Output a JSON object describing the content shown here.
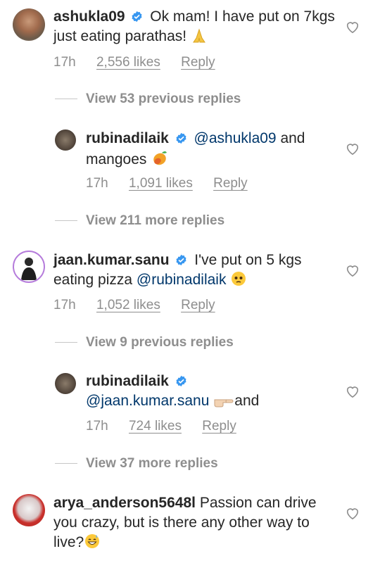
{
  "comments": [
    {
      "username": "ashukla09",
      "text_before": "Ok mam! I have put on 7kgs just eating parathas!",
      "time": "17h",
      "likes": "2,556 likes",
      "reply": "Reply"
    },
    {
      "username": "rubinadilaik",
      "mention": "@ashukla09",
      "text_after": " and mangoes",
      "time": "17h",
      "likes": "1,091 likes",
      "reply": "Reply"
    },
    {
      "username": "jaan.kumar.sanu",
      "text_before": "I've put on 5 kgs eating pizza",
      "mention": "@rubinadilaik",
      "time": "17h",
      "likes": "1,052 likes",
      "reply": "Reply"
    },
    {
      "username": "rubinadilaik",
      "mention": "@jaan.kumar.sanu",
      "text_after": "and",
      "time": "17h",
      "likes": "724 likes",
      "reply": "Reply"
    },
    {
      "username": "arya_anderson5648l",
      "text_before": "Passion can drive you crazy, but is there any other way to live?"
    }
  ],
  "view_rows": [
    "View 53 previous replies",
    "View 211 more replies",
    "View 9 previous replies",
    "View 37 more replies"
  ],
  "icons": {
    "verified": "verified-badge-icon",
    "heart": "heart-outline-icon",
    "praying_hands": "praying-hands-emoji",
    "mango": "mango-emoji",
    "pleading_face": "pleading-face-emoji",
    "pointing_hand": "pointing-hand-emoji",
    "grinning_sweat": "grinning-sweat-emoji"
  },
  "colors": {
    "verified": "#3897f0",
    "mention": "#00376b",
    "secondary": "#8e8e8e"
  }
}
